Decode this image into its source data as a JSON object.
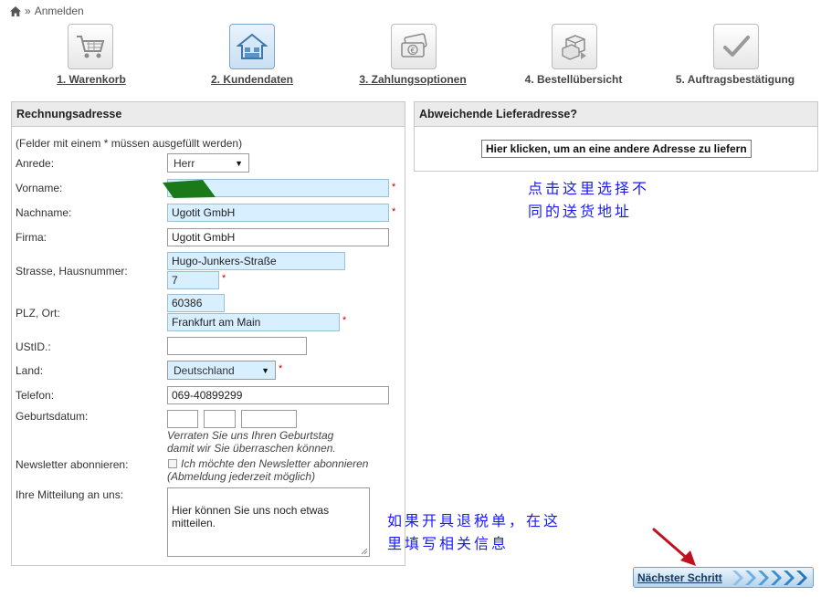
{
  "breadcrumb": {
    "separator": "»",
    "current": "Anmelden"
  },
  "steps": [
    {
      "label": "1. Warenkorb"
    },
    {
      "label": "2. Kundendaten"
    },
    {
      "label": "3. Zahlungsoptionen"
    },
    {
      "label": "4. Bestellübersicht"
    },
    {
      "label": "5. Auftragsbestätigung"
    }
  ],
  "billing": {
    "title": "Rechnungsadresse",
    "required_note": "(Felder mit einem * müssen ausgefüllt werden)",
    "required_mark": "*",
    "salutation": {
      "label": "Anrede:",
      "value": "Herr"
    },
    "firstname": {
      "label": "Vorname:",
      "value": ""
    },
    "lastname": {
      "label": "Nachname:",
      "value": "Ugotit GmbH"
    },
    "company": {
      "label": "Firma:",
      "value": "Ugotit GmbH"
    },
    "street": {
      "label": "Strasse, Hausnummer:",
      "street_value": "Hugo-Junkers-Straße",
      "number_value": "7"
    },
    "city": {
      "label": "PLZ, Ort:",
      "zip_value": "60386",
      "city_value": "Frankfurt am Main"
    },
    "vat": {
      "label": "UStID.:",
      "value": ""
    },
    "country": {
      "label": "Land:",
      "value": "Deutschland"
    },
    "phone": {
      "label": "Telefon:",
      "value": "069-40899299"
    },
    "birthday": {
      "label": "Geburtsdatum:",
      "hint_line1": "Verraten Sie uns Ihren Geburtstag",
      "hint_line2": "damit wir Sie überraschen können."
    },
    "newsletter": {
      "label": "Newsletter abonnieren:",
      "checkbox_label": "Ich möchte den Newsletter abonnieren",
      "hint": "(Abmeldung jederzeit möglich)",
      "checked": false
    },
    "message": {
      "label": "Ihre Mitteilung an uns:",
      "value": "Hier können Sie uns noch etwas\nmitteilen."
    }
  },
  "shipping": {
    "title": "Abweichende Lieferadresse?",
    "button_label": "Hier klicken, um an eine andere Adresse zu liefern"
  },
  "annotations": {
    "shipping_note_line1": "点击这里选择不",
    "shipping_note_line2": "同的送货地址",
    "message_note_line1": "如果开具退税单，在这",
    "message_note_line2": "里填写相关信息"
  },
  "next_button": {
    "label": "Nächster Schritt"
  },
  "colors": {
    "required_field_bg": "#d8efff",
    "annotation_text": "#1a1aff",
    "annotation_arrow": "#c0121e",
    "redaction_mark": "#1a7a1a",
    "required_star": "#cc0000"
  }
}
